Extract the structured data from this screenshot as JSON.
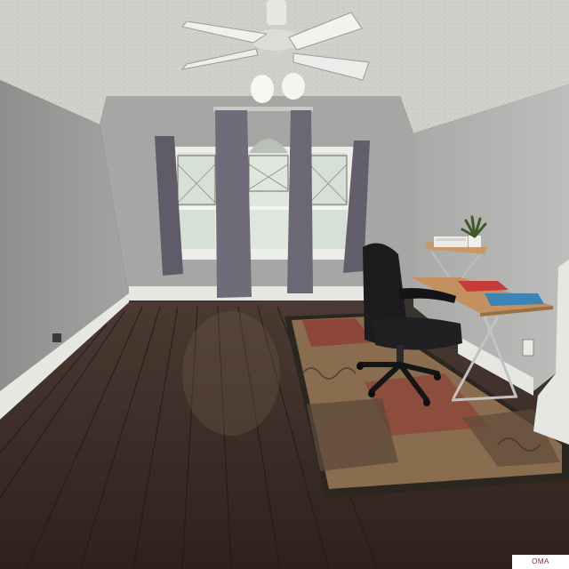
{
  "scene": {
    "subject": "empty-room-with-desk",
    "objects": [
      "ceiling-fan",
      "window",
      "curtains",
      "office-chair",
      "desk",
      "area-rug",
      "potted-plant",
      "printer",
      "hardwood-floor"
    ],
    "colors": {
      "ceiling": "#cfcdc8",
      "wall_back": "#a7a8a6",
      "wall_left": "#9a9b99",
      "wall_right": "#b0b1ae",
      "baseboard": "#e8e8e4",
      "floor": "#3b2b23",
      "curtain": "#6f6b78",
      "window_glass": "#d9e3da",
      "desk_top": "#c2915f",
      "chair": "#1c1c1f",
      "rug_base": "#8a6c4e",
      "rug_accent": "#8d4036"
    }
  },
  "watermark": {
    "text": "OMA"
  }
}
